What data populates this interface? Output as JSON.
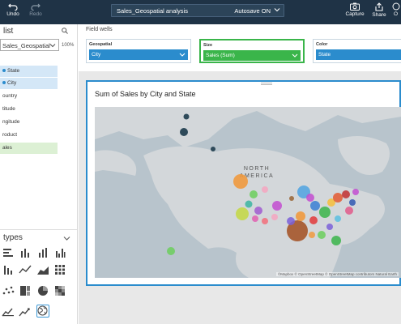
{
  "toolbar": {
    "undo_label": "Undo",
    "redo_label": "Redo",
    "analysis_title": "Sales_Geospatial analysis",
    "autosave_label": "Autosave ON",
    "capture_label": "Capture",
    "share_label": "Share",
    "overflow_label": "O"
  },
  "fields_panel": {
    "heading": "list",
    "dataset": "Sales_Geospatial",
    "zoom": "100%",
    "fields": [
      {
        "label": "State",
        "state": "selected-blue"
      },
      {
        "label": "City",
        "state": "selected-blue"
      },
      {
        "label": "ountry",
        "state": "none"
      },
      {
        "label": "titude",
        "state": "none"
      },
      {
        "label": "ngitude",
        "state": "none"
      },
      {
        "label": "roduct",
        "state": "none"
      },
      {
        "label": "ales",
        "state": "selected-green"
      }
    ]
  },
  "visual_types": {
    "heading": "types",
    "active": "geospatial-map"
  },
  "field_wells": {
    "label": "Field wells",
    "wells": [
      {
        "title": "Geospatial",
        "value": "City",
        "color": "#2b8ccd"
      },
      {
        "title": "Size",
        "value": "Sales (Sum)",
        "color": "#3ab54a"
      },
      {
        "title": "Color",
        "value": "State",
        "color": "#2b8ccd"
      }
    ]
  },
  "visual": {
    "title": "Sum of Sales by City and State",
    "map_label": "NORTH\nAMERICA",
    "map_label_line1": "NORTH",
    "map_label_line2": "AMERICA",
    "attribution": "©Mapbox © OpenStreetMap © OpenStreetMap contributors Natural Earth",
    "map_land_color": "#d3d7da",
    "map_water_color": "#b8c4cc"
  }
}
